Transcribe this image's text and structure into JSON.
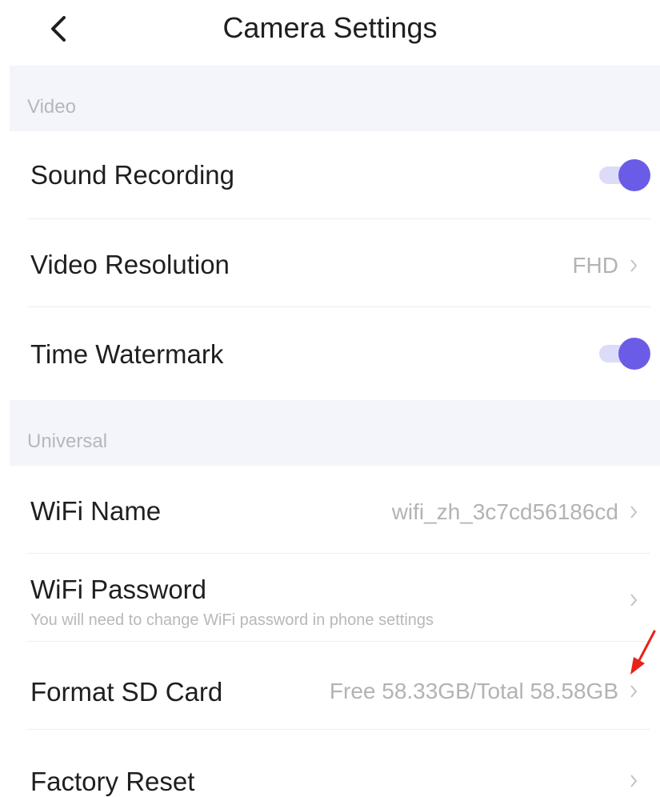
{
  "header": {
    "title": "Camera Settings",
    "back_icon": "chevron-left-icon"
  },
  "colors": {
    "accent": "#6b5ce7",
    "section_bg": "#f3f5fa",
    "annotation": "#e8231b"
  },
  "sections": [
    {
      "title": "Video",
      "rows": [
        {
          "label": "Sound Recording",
          "control": "toggle",
          "on": true
        },
        {
          "label": "Video Resolution",
          "control": "value",
          "value": "FHD"
        },
        {
          "label": "Time Watermark",
          "control": "toggle",
          "on": true
        }
      ]
    },
    {
      "title": "Universal",
      "rows": [
        {
          "label": "WiFi Name",
          "control": "value",
          "value": "wifi_zh_3c7cd56186cd"
        },
        {
          "label": "WiFi Password",
          "control": "chevron",
          "subtitle": "You will need to change WiFi password in phone settings"
        },
        {
          "label": "Format SD Card",
          "control": "value",
          "value": "Free 58.33GB/Total 58.58GB"
        },
        {
          "label": "Factory Reset",
          "control": "chevron"
        }
      ]
    }
  ],
  "annotation": {
    "icon": "red-arrow-icon"
  }
}
